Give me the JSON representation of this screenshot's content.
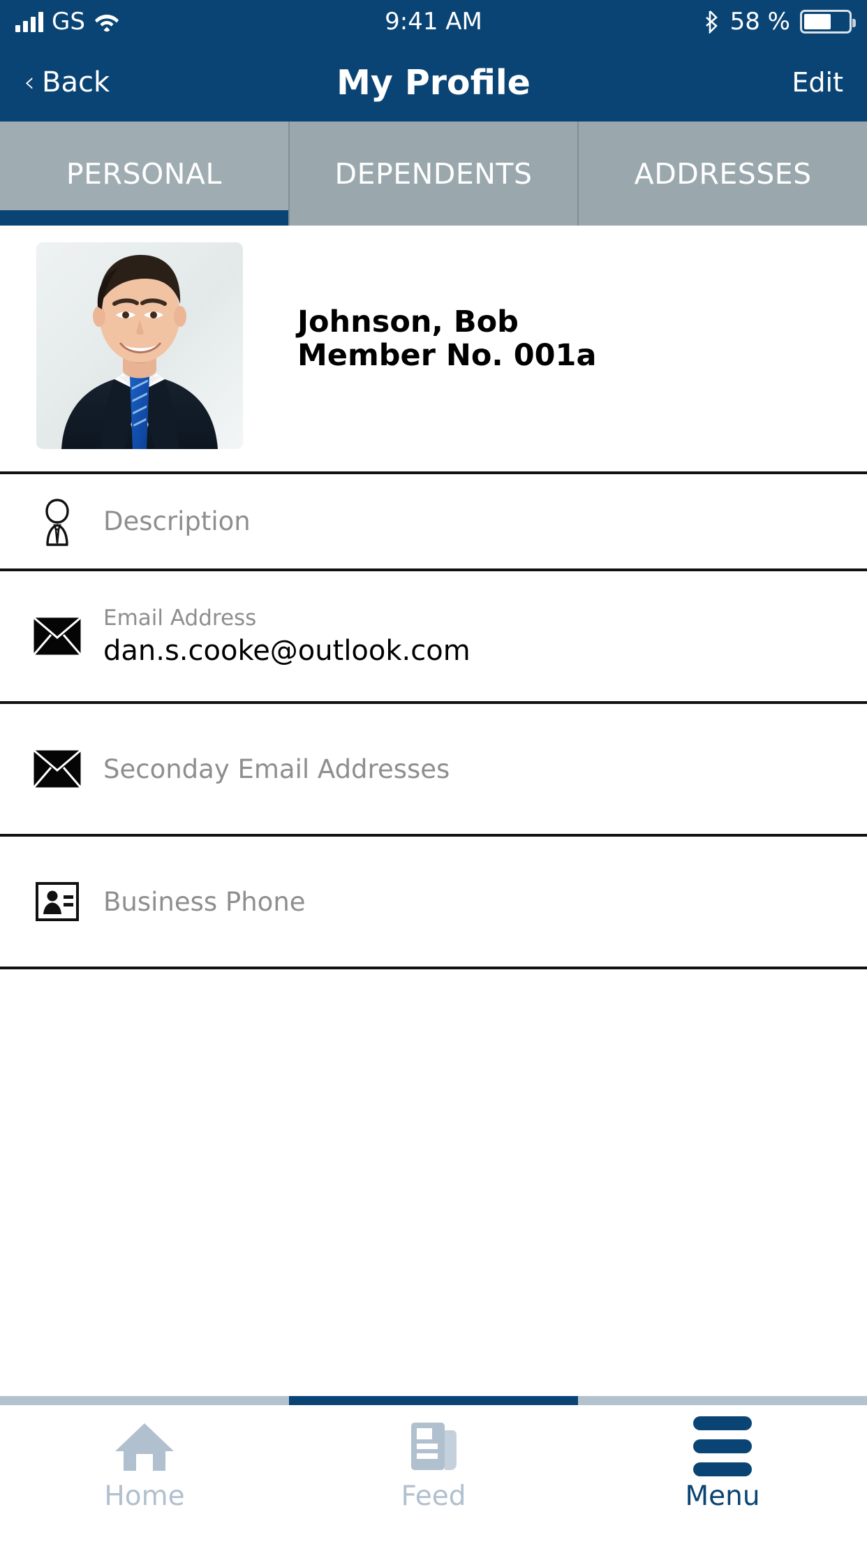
{
  "status_bar": {
    "carrier": "GS",
    "time": "9:41 AM",
    "battery_percent": "58 %",
    "signal_icon": "signal-bars-icon",
    "wifi_icon": "wifi-icon",
    "bluetooth_icon": "bluetooth-icon",
    "battery_icon": "battery-icon",
    "battery_fill_ratio": 0.62
  },
  "nav_bar": {
    "back_chevron": "‹",
    "back_label": "Back",
    "title": "My Profile",
    "edit_label": "Edit"
  },
  "tabs": {
    "active_index": 0,
    "items": [
      {
        "label": "PERSONAL"
      },
      {
        "label": "DEPENDENTS"
      },
      {
        "label": "ADDRESSES"
      }
    ]
  },
  "profile": {
    "avatar_icon": "profile-photo",
    "name": "Johnson, Bob",
    "member_no": "Member No. 001a"
  },
  "fields": [
    {
      "icon": "person-tie-icon",
      "label": "",
      "placeholder": "Description",
      "value": ""
    },
    {
      "icon": "envelope-icon",
      "label": "Email Address",
      "placeholder": "",
      "value": "dan.s.cooke@outlook.com"
    },
    {
      "icon": "envelope-icon",
      "label": "",
      "placeholder": "Seconday Email Addresses",
      "value": ""
    },
    {
      "icon": "contact-card-icon",
      "label": "",
      "placeholder": "Business Phone",
      "value": ""
    }
  ],
  "bottom_bar": {
    "indicator_active_segment": 1,
    "items": [
      {
        "label": "Home",
        "icon": "home-icon",
        "active": false
      },
      {
        "label": "Feed",
        "icon": "feed-icon",
        "active": false
      },
      {
        "label": "Menu",
        "icon": "hamburger-icon",
        "active": true
      }
    ]
  },
  "colors": {
    "brand_blue": "#0a4474",
    "tab_gray": "#9aa8ad",
    "muted_text": "#8e8e8e",
    "tabbar_inactive": "#b0c0ce"
  }
}
